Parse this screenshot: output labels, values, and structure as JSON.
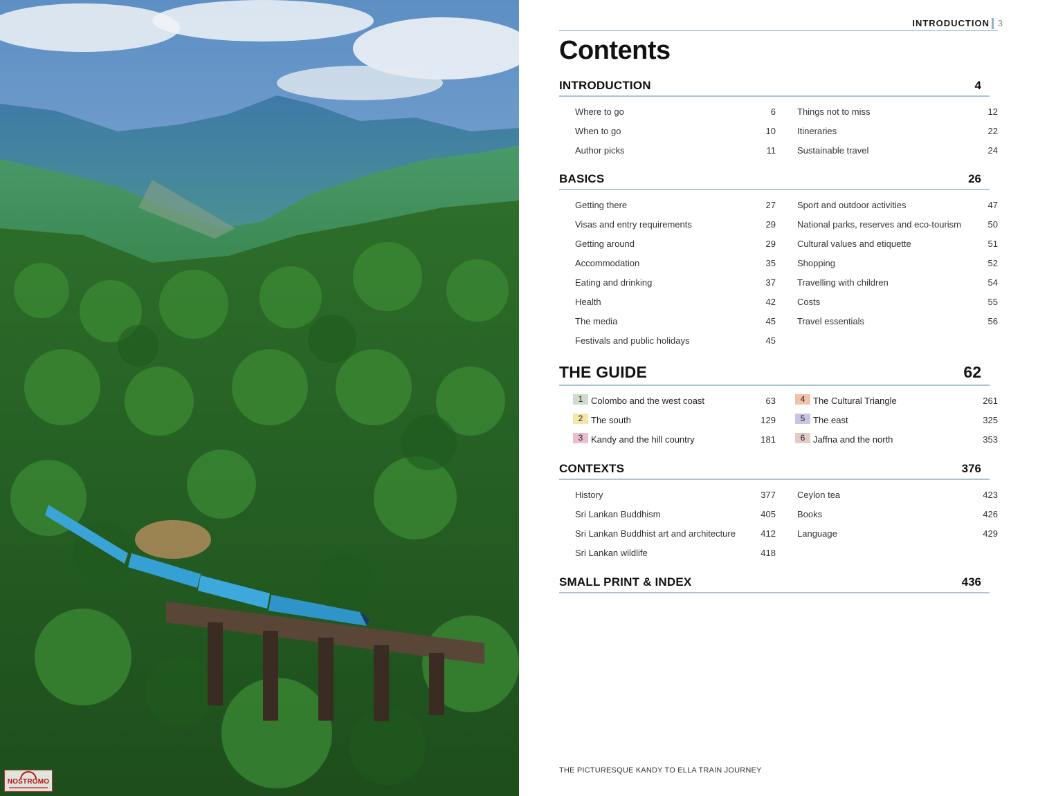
{
  "header": {
    "running_title": "INTRODUCTION",
    "page_number": "3"
  },
  "title": "Contents",
  "sections": {
    "introduction": {
      "title": "INTRODUCTION",
      "page": "4",
      "left": [
        {
          "label": "Where to go",
          "page": "6"
        },
        {
          "label": "When to go",
          "page": "10"
        },
        {
          "label": "Author picks",
          "page": "11"
        }
      ],
      "right": [
        {
          "label": "Things not to miss",
          "page": "12"
        },
        {
          "label": "Itineraries",
          "page": "22"
        },
        {
          "label": "Sustainable travel",
          "page": "24"
        }
      ]
    },
    "basics": {
      "title": "BASICS",
      "page": "26",
      "left": [
        {
          "label": "Getting there",
          "page": "27"
        },
        {
          "label": "Visas and entry requirements",
          "page": "29"
        },
        {
          "label": "Getting around",
          "page": "29"
        },
        {
          "label": "Accommodation",
          "page": "35"
        },
        {
          "label": "Eating and drinking",
          "page": "37"
        },
        {
          "label": "Health",
          "page": "42"
        },
        {
          "label": "The media",
          "page": "45"
        },
        {
          "label": "Festivals and public holidays",
          "page": "45"
        }
      ],
      "right": [
        {
          "label": "Sport and outdoor activities",
          "page": "47"
        },
        {
          "label": "National parks, reserves and eco-tourism",
          "page": "50"
        },
        {
          "label": "Cultural values and etiquette",
          "page": "51"
        },
        {
          "label": "Shopping",
          "page": "52"
        },
        {
          "label": "Travelling with children",
          "page": "54"
        },
        {
          "label": "Costs",
          "page": "55"
        },
        {
          "label": "Travel essentials",
          "page": "56"
        }
      ]
    },
    "guide": {
      "title": "THE GUIDE",
      "page": "62",
      "left": [
        {
          "num": "1",
          "label": "Colombo and the west coast",
          "page": "63",
          "color": "#cfdccb"
        },
        {
          "num": "2",
          "label": "The south",
          "page": "129",
          "color": "#f3e6a6"
        },
        {
          "num": "3",
          "label": "Kandy and the hill country",
          "page": "181",
          "color": "#e9bcd2"
        }
      ],
      "right": [
        {
          "num": "4",
          "label": "The Cultural Triangle",
          "page": "261",
          "color": "#f2c2a8"
        },
        {
          "num": "5",
          "label": "The east",
          "page": "325",
          "color": "#c8c6e0"
        },
        {
          "num": "6",
          "label": "Jaffna and the north",
          "page": "353",
          "color": "#e3cbc6"
        }
      ]
    },
    "contexts": {
      "title": "CONTEXTS",
      "page": "376",
      "left": [
        {
          "label": "History",
          "page": "377"
        },
        {
          "label": "Sri Lankan Buddhism",
          "page": "405"
        },
        {
          "label": "Sri Lankan Buddhist art and architecture",
          "page": "412"
        },
        {
          "label": "Sri Lankan wildlife",
          "page": "418"
        }
      ],
      "right": [
        {
          "label": "Ceylon tea",
          "page": "423"
        },
        {
          "label": "Books",
          "page": "426"
        },
        {
          "label": "Language",
          "page": "429"
        }
      ]
    },
    "smallprint": {
      "title": "SMALL PRINT & INDEX",
      "page": "436"
    }
  },
  "caption": "THE PICTURESQUE KANDY TO ELLA TRAIN JOURNEY",
  "logo": {
    "text": "NOSTROMO"
  }
}
